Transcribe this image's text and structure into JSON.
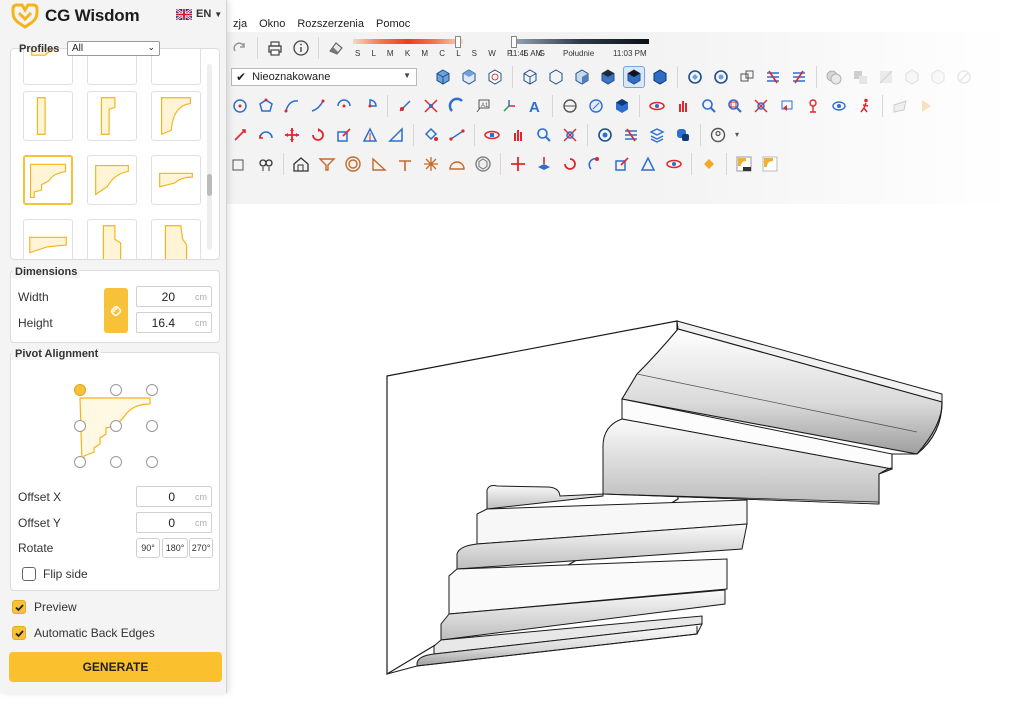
{
  "menu": [
    "zja",
    "Okno",
    "Rozszerzenia",
    "Pomoc"
  ],
  "shadows": {
    "letters": "S L M K M C L S W P L G",
    "time_start": "11:45 AM",
    "time_mid": "Południe",
    "time_end": "11:03 PM"
  },
  "tag": {
    "value": "Nieoznakowane"
  },
  "brand": {
    "name": "CG Wisdom",
    "lang": "EN"
  },
  "profiles": {
    "title": "Profiles",
    "filter": "All"
  },
  "dimensions": {
    "title": "Dimensions",
    "width_label": "Width",
    "width_value": "20",
    "height_label": "Height",
    "height_value": "16.4",
    "unit": "cm"
  },
  "pivot": {
    "title": "Pivot Alignment",
    "offset_x_label": "Offset X",
    "offset_x_value": "0",
    "offset_y_label": "Offset Y",
    "offset_y_value": "0",
    "rotate_label": "Rotate",
    "rot_90": "90°",
    "rot_180": "180°",
    "rot_270": "270°",
    "flip_label": "Flip side",
    "flip_checked": false,
    "unit": "cm"
  },
  "options": {
    "preview_label": "Preview",
    "preview_checked": true,
    "back_edges_label": "Automatic Back Edges",
    "back_edges_checked": true
  },
  "generate_label": "GENERATE",
  "colors": {
    "accent": "#fbc02d",
    "toolbar_red": "#e3252d",
    "toolbar_blue": "#2d6fcf"
  }
}
